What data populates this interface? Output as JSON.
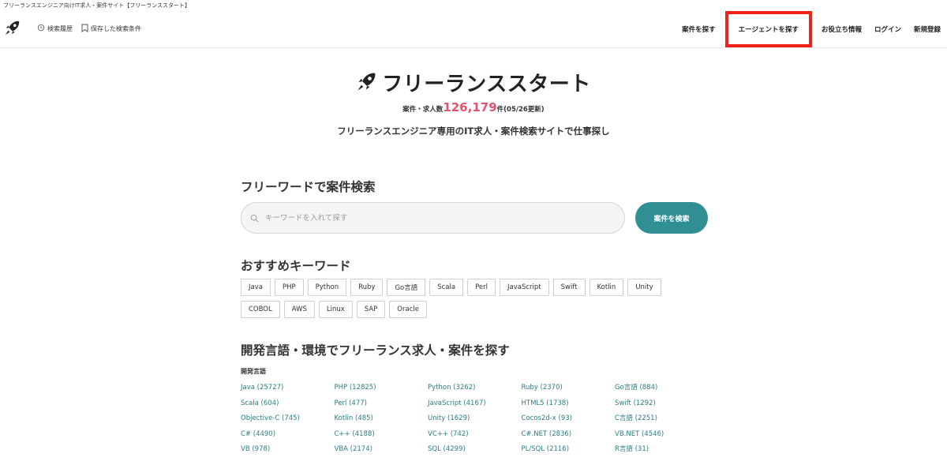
{
  "page_title": "フリーランスエンジニア向けIT求人・案件サイト【フリーランススタート】",
  "header": {
    "logo_icon": "rocket-icon",
    "history_label": "検索履歴",
    "saved_label": "保存した検索条件",
    "nav": [
      "案件を探す",
      "エージェントを探す",
      "お役立ち情報",
      "ログイン",
      "新規登録"
    ],
    "highlight_color": "#f0231a"
  },
  "hero": {
    "brand": "フリーランススタート",
    "count_prefix": "案件・求人数",
    "count_value": "126,179",
    "count_suffix": "件(05/26更新)",
    "tagline": "フリーランスエンジニア専用のIT求人・案件検索サイトで仕事探し"
  },
  "search": {
    "heading": "フリーワードで案件検索",
    "placeholder": "キーワードを入れて探す",
    "button": "案件を検索",
    "button_color": "#2f8f93"
  },
  "keywords": {
    "heading": "おすすめキーワード",
    "items": [
      "Java",
      "PHP",
      "Python",
      "Ruby",
      "Go言語",
      "Scala",
      "Perl",
      "JavaScript",
      "Swift",
      "Kotlin",
      "Unity",
      "COBOL",
      "AWS",
      "Linux",
      "SAP",
      "Oracle"
    ]
  },
  "languages": {
    "heading": "開発言語・環境でフリーランス求人・案件を探す",
    "category": "開発言語",
    "items": [
      "Java (25727)",
      "PHP (12825)",
      "Python (3262)",
      "Ruby (2370)",
      "Go言語 (884)",
      "Scala (604)",
      "Perl (477)",
      "JavaScript (4167)",
      "HTML5 (1738)",
      "Swift (1292)",
      "Objective-C (745)",
      "Kotlin (485)",
      "Unity (1629)",
      "Cocos2d-x (93)",
      "C言語 (2251)",
      "C# (4490)",
      "C++ (4188)",
      "VC++ (742)",
      "C#.NET (2836)",
      "VB.NET (4546)",
      "VB (978)",
      "VBA (2174)",
      "SQL (4299)",
      "PL/SQL (2116)",
      "R言語 (31)"
    ]
  }
}
